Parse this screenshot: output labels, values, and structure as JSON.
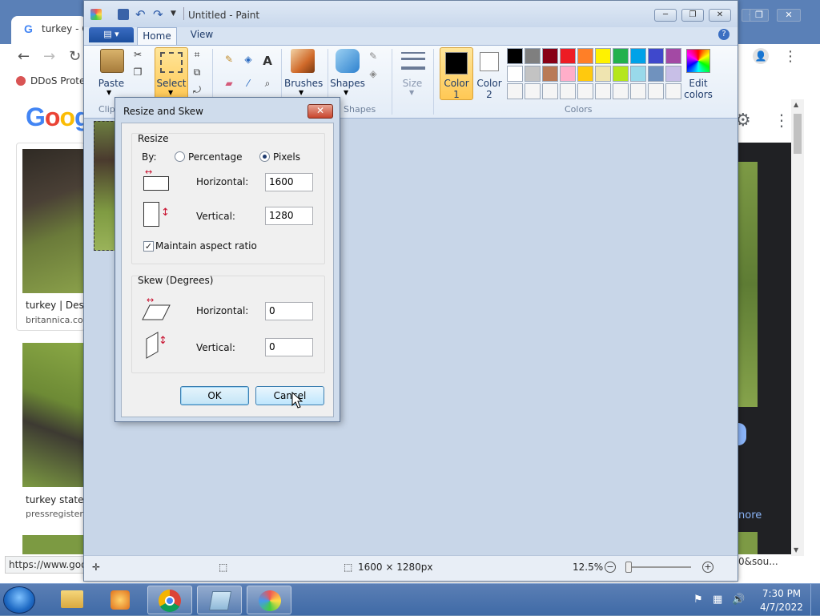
{
  "browser": {
    "tab_title": "turkey - G",
    "tab_icon": "G",
    "bookmark": "DDoS Prote",
    "google_logo": "Goog",
    "results": [
      {
        "title": "turkey | Desc",
        "source": "britannica.com"
      },
      {
        "title": "turkey states",
        "source": "pressregister.c"
      }
    ],
    "more_label": "nore",
    "status_url": "https://www.goo",
    "status_right": "0&sou..."
  },
  "paint": {
    "title": "Untitled - Paint",
    "file_label": "▤ ▾",
    "tabs": {
      "home": "Home",
      "view": "View"
    },
    "ribbon": {
      "paste": "Paste",
      "select": "Select",
      "brushes": "Brushes",
      "shapes": "Shapes",
      "size": "Size",
      "color1": "Color\n1",
      "color1_a": "Color",
      "color1_b": "1",
      "color2_a": "Color",
      "color2_b": "2",
      "edit_colors_a": "Edit",
      "edit_colors_b": "colors",
      "group_clipboard": "Clip",
      "group_shapes": "Shapes",
      "group_colors": "Colors"
    },
    "palette": [
      "#000000",
      "#7f7f7f",
      "#880015",
      "#ed1c24",
      "#ff7f27",
      "#fff200",
      "#22b14c",
      "#00a2e8",
      "#3f48cc",
      "#a349a4",
      "#ffffff",
      "#c3c3c3",
      "#b97a57",
      "#ffaec9",
      "#ffc90e",
      "#efe4b0",
      "#b5e61d",
      "#99d9ea",
      "#7092be",
      "#c8bfe7",
      "#f5f5f5",
      "#f5f5f5",
      "#f5f5f5",
      "#f5f5f5",
      "#f5f5f5",
      "#f5f5f5",
      "#f5f5f5",
      "#f5f5f5",
      "#f5f5f5",
      "#f5f5f5"
    ],
    "status": {
      "size": "1600 × 1280px",
      "zoom": "12.5%"
    }
  },
  "dialog": {
    "title": "Resize and Skew",
    "close": "✕",
    "resize_group": "Resize",
    "by_label": "By:",
    "percentage": "Percentage",
    "pixels": "Pixels",
    "selected_mode": "pixels",
    "horizontal_label": "Horizontal:",
    "vertical_label": "Vertical:",
    "resize_h": "1600",
    "resize_v": "1280",
    "maintain_aspect": "Maintain aspect ratio",
    "maintain_checked": true,
    "skew_group": "Skew (Degrees)",
    "skew_h": "0",
    "skew_v": "0",
    "ok": "OK",
    "cancel": "Cancel"
  },
  "taskbar": {
    "time": "7:30 PM",
    "date": "4/7/2022"
  },
  "colors": {
    "accent_red": "#c8102e",
    "taskbar": "#4a73ad",
    "ribbon_highlight": "#ffd36b"
  }
}
